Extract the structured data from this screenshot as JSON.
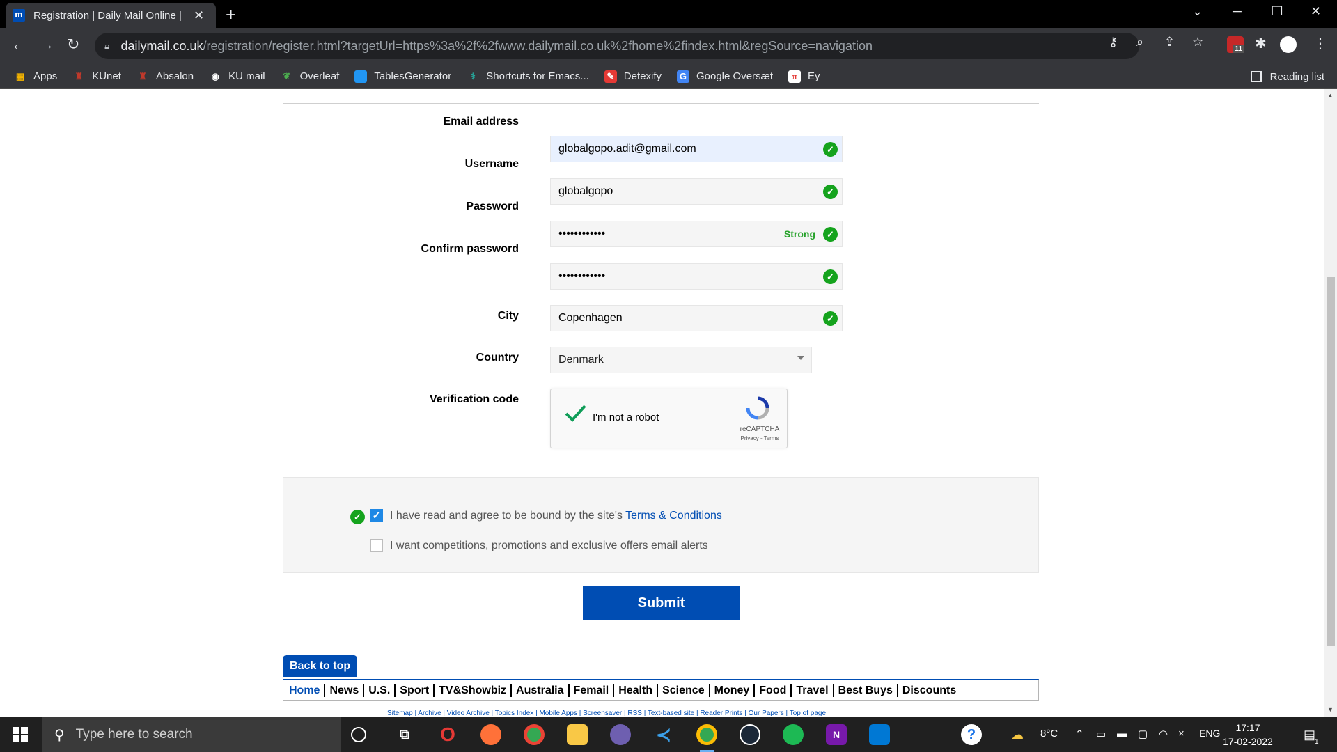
{
  "browser": {
    "tab_title": "Registration | Daily Mail Online |",
    "tab_favicon_letter": "m",
    "url_domain": "dailymail.co.uk",
    "url_path": "/registration/register.html?targetUrl=https%3a%2f%2fwww.dailymail.co.uk%2fhome%2findex.html&regSource=navigation",
    "bookmarks": [
      {
        "label": "Apps",
        "icon": "apps-grid-icon",
        "color": "#f4b400"
      },
      {
        "label": "KUnet",
        "icon": "kunet-icon",
        "color": "#c0392b"
      },
      {
        "label": "Absalon",
        "icon": "absalon-icon",
        "color": "#c0392b"
      },
      {
        "label": "KU mail",
        "icon": "mail-icon",
        "color": "#ffffff"
      },
      {
        "label": "Overleaf",
        "icon": "overleaf-icon",
        "color": "#4cae4f"
      },
      {
        "label": "TablesGenerator",
        "icon": "table-icon",
        "color": "#2196f3"
      },
      {
        "label": "Shortcuts for Emacs...",
        "icon": "emacs-icon",
        "color": "#26a69a"
      },
      {
        "label": "Detexify",
        "icon": "detexify-icon",
        "color": "#e53935"
      },
      {
        "label": "Google Oversæt",
        "icon": "translate-icon",
        "color": "#4285f4"
      },
      {
        "label": "Ey",
        "icon": "ey-icon",
        "color": "#e53935"
      }
    ],
    "reading_list": "Reading list",
    "extension_badge": "11"
  },
  "form": {
    "fields": [
      {
        "label": "Email address",
        "value": "globalgopo.adit@gmail.com",
        "valid": true
      },
      {
        "label": "Username",
        "value": "globalgopo",
        "valid": true
      },
      {
        "label": "Password",
        "value": "••••••••••••",
        "strength": "Strong",
        "valid": true
      },
      {
        "label": "Confirm password",
        "value": "••••••••••••",
        "valid": true
      },
      {
        "label": "City",
        "value": "Copenhagen",
        "valid": true
      }
    ],
    "country_label": "Country",
    "country_value": "Denmark",
    "verification_label": "Verification code",
    "captcha": {
      "label": "I'm not a robot",
      "brand": "reCAPTCHA",
      "links": "Privacy - Terms"
    },
    "terms_prefix": "I have read and agree to be bound by the site's ",
    "terms_link": "Terms & Conditions",
    "terms_checked": true,
    "offers_text": "I want competitions, promotions and exclusive offers email alerts",
    "offers_checked": false,
    "submit_label": "Submit"
  },
  "footer": {
    "back_to_top": "Back to top",
    "nav": [
      "Home",
      "News",
      "U.S.",
      "Sport",
      "TV&Showbiz",
      "Australia",
      "Femail",
      "Health",
      "Science",
      "Money",
      "Food",
      "Travel",
      "Best Buys",
      "Discounts"
    ],
    "links": "Sitemap | Archive | Video Archive | Topics Index | Mobile Apps | Screensaver | RSS | Text-based site | Reader Prints | Our Papers | Top of page"
  },
  "taskbar": {
    "search_placeholder": "Type here to search",
    "weather": "8°C",
    "language": "ENG",
    "time": "17:17",
    "date": "17-02-2022",
    "notification_count": "1"
  },
  "colors": {
    "brand_blue": "#004db3",
    "valid_green": "#15a31d"
  }
}
